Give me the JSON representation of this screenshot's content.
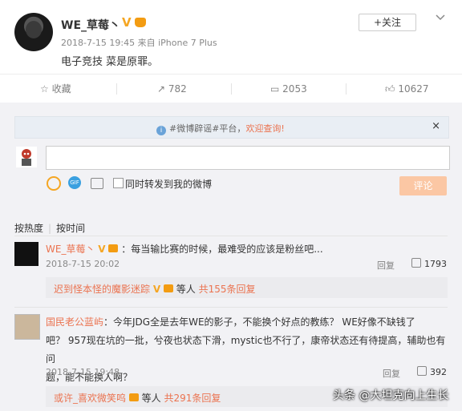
{
  "post": {
    "username": "WE_草莓丶",
    "verified_badge": "V",
    "meta": "2018-7-15 19:45 来自 iPhone 7 Plus",
    "text": "电子竞技 菜是原罪。",
    "follow_label": "+关注",
    "menu_icon": "chevron-down-icon"
  },
  "actions": {
    "favorite": "收藏",
    "repost": "782",
    "comment": "2053",
    "like": "10627"
  },
  "notice": {
    "prefix": "#微博辟谣#平台，",
    "highlight": "欢迎查询!",
    "close": "×"
  },
  "composer": {
    "placeholder": "",
    "repost_checkbox_label": "同时转发到我的微博",
    "submit_label": "评论",
    "gif_label": "GIF"
  },
  "sort": {
    "hot": "按热度",
    "time": "按时间"
  },
  "comments": [
    {
      "user": "WE_草莓丶",
      "badge": "V",
      "text": "：每当输比赛的时候，最难受的应该是粉丝吧...",
      "date": "2018-7-15 20:02",
      "reply": "回复",
      "likes": "1793",
      "thread_user": "迟到怪本怪的魔影迷踪",
      "thread_badge": "V",
      "thread_mid": " 等人 ",
      "thread_count": "共155条回复"
    },
    {
      "user": "国民老公蓝屿",
      "text_line1": "：今年JDG全是去年WE的影子，不能换个好点的教练？ WE好像不缺钱了",
      "text_line2": "吧？  957现在坑的一批，兮夜也状态下滑，mystic也不行了，康帝状态还有待提高，辅助也有问",
      "text_line3": "题，能不能换人啊？",
      "date": "2018-7-15 19:48",
      "reply": "回复",
      "likes": "392",
      "thread_user": "或许_喜欢微笑呜",
      "thread_mid": " 等人 ",
      "thread_count": "共291条回复"
    }
  ],
  "watermark": "头条 @大坦克向上生长"
}
